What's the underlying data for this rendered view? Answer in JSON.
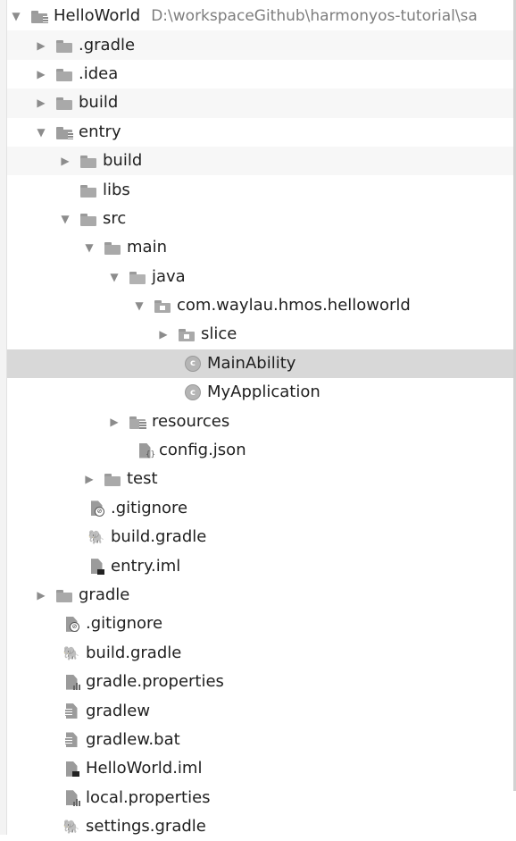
{
  "tree": {
    "root_label": "HelloWorld",
    "root_path": "D:\\workspaceGithub\\harmonyos-tutorial\\sa",
    "items": [
      {
        "label": ".gradle"
      },
      {
        "label": ".idea"
      },
      {
        "label": "build"
      },
      {
        "label": "entry"
      },
      {
        "label": "build"
      },
      {
        "label": "libs"
      },
      {
        "label": "src"
      },
      {
        "label": "main"
      },
      {
        "label": "java"
      },
      {
        "label": "com.waylau.hmos.helloworld"
      },
      {
        "label": "slice"
      },
      {
        "label": "MainAbility"
      },
      {
        "label": "MyApplication"
      },
      {
        "label": "resources"
      },
      {
        "label": "config.json"
      },
      {
        "label": "test"
      },
      {
        "label": ".gitignore"
      },
      {
        "label": "build.gradle"
      },
      {
        "label": "entry.iml"
      },
      {
        "label": "gradle"
      },
      {
        "label": ".gitignore"
      },
      {
        "label": "build.gradle"
      },
      {
        "label": "gradle.properties"
      },
      {
        "label": "gradlew"
      },
      {
        "label": "gradlew.bat"
      },
      {
        "label": "HelloWorld.iml"
      },
      {
        "label": "local.properties"
      },
      {
        "label": "settings.gradle"
      }
    ],
    "selected_item": "MainAbility"
  },
  "icons": {
    "expanded": "chevron-down-icon",
    "collapsed": "chevron-right-icon",
    "folder": "folder-icon",
    "class": "java-class-icon"
  },
  "colors": {
    "selection_bg": "#d8d8d8",
    "text": "#1f1f1f",
    "path_text": "#7d7d7d"
  }
}
